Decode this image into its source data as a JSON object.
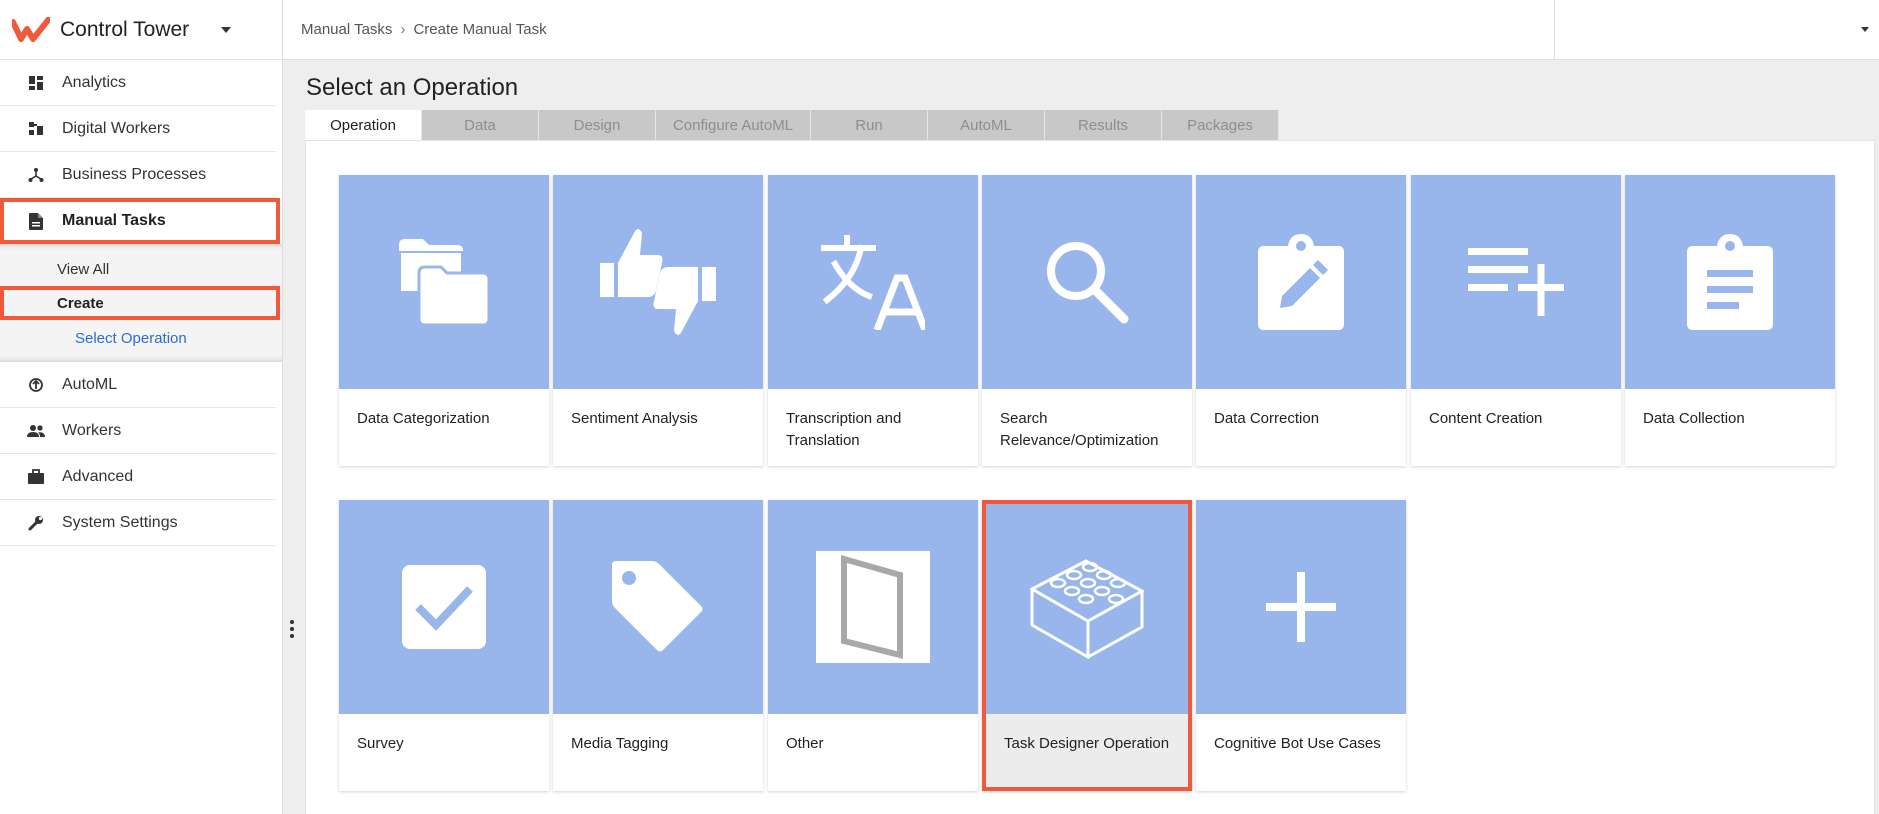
{
  "app": {
    "title": "Control Tower"
  },
  "sidebar": {
    "items": [
      {
        "label": "Analytics",
        "icon": "dashboard-icon"
      },
      {
        "label": "Digital Workers",
        "icon": "digital-workers-icon"
      },
      {
        "label": "Business Processes",
        "icon": "process-icon"
      },
      {
        "label": "Manual Tasks",
        "icon": "document-icon",
        "active": true
      },
      {
        "label": "AutoML",
        "icon": "automl-icon"
      },
      {
        "label": "Workers",
        "icon": "people-icon"
      },
      {
        "label": "Advanced",
        "icon": "briefcase-icon"
      },
      {
        "label": "System Settings",
        "icon": "wrench-icon"
      }
    ],
    "sub": {
      "view_all": "View All",
      "create": "Create",
      "select_operation": "Select Operation"
    }
  },
  "header": {
    "breadcrumb": [
      "Manual Tasks",
      "Create Manual Task"
    ]
  },
  "main": {
    "title": "Select an Operation",
    "tabs": [
      "Operation",
      "Data",
      "Design",
      "Configure AutoML",
      "Run",
      "AutoML",
      "Results",
      "Packages"
    ],
    "operations": [
      {
        "label": "Data Categorization",
        "icon": "folders-icon"
      },
      {
        "label": "Sentiment Analysis",
        "icon": "thumbs-up-down-icon"
      },
      {
        "label": "Transcription and Translation",
        "icon": "translate-icon"
      },
      {
        "label": "Search Relevance/Optimization",
        "icon": "search-icon"
      },
      {
        "label": "Data Correction",
        "icon": "edit-clipboard-icon"
      },
      {
        "label": "Content Creation",
        "icon": "playlist-add-icon"
      },
      {
        "label": "Data Collection",
        "icon": "clipboard-icon"
      },
      {
        "label": "Survey",
        "icon": "checkbox-icon"
      },
      {
        "label": "Media Tagging",
        "icon": "tag-icon"
      },
      {
        "label": "Other",
        "icon": "frame-icon"
      },
      {
        "label": "Task Designer Operation",
        "icon": "lego-brick-icon",
        "selected": true
      },
      {
        "label": "Cognitive Bot Use Cases",
        "icon": "plus-icon"
      }
    ]
  },
  "colors": {
    "accent": "#f05a3a",
    "tile": "#98b6ec",
    "link": "#2c6bd6"
  }
}
